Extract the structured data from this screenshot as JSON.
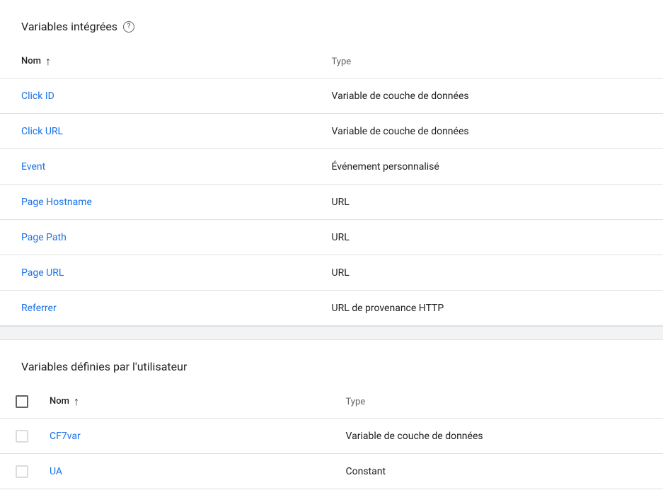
{
  "section1": {
    "title": "Variables intégrées",
    "columns": {
      "name": "Nom",
      "type": "Type"
    },
    "rows": [
      {
        "name": "Click ID",
        "type": "Variable de couche de données"
      },
      {
        "name": "Click URL",
        "type": "Variable de couche de données"
      },
      {
        "name": "Event",
        "type": "Événement personnalisé"
      },
      {
        "name": "Page Hostname",
        "type": "URL"
      },
      {
        "name": "Page Path",
        "type": "URL"
      },
      {
        "name": "Page URL",
        "type": "URL"
      },
      {
        "name": "Referrer",
        "type": "URL de provenance HTTP"
      }
    ]
  },
  "section2": {
    "title": "Variables définies par l'utilisateur",
    "columns": {
      "name": "Nom",
      "type": "Type"
    },
    "rows": [
      {
        "name": "CF7var",
        "type": "Variable de couche de données"
      },
      {
        "name": "UA",
        "type": "Constant"
      }
    ]
  }
}
